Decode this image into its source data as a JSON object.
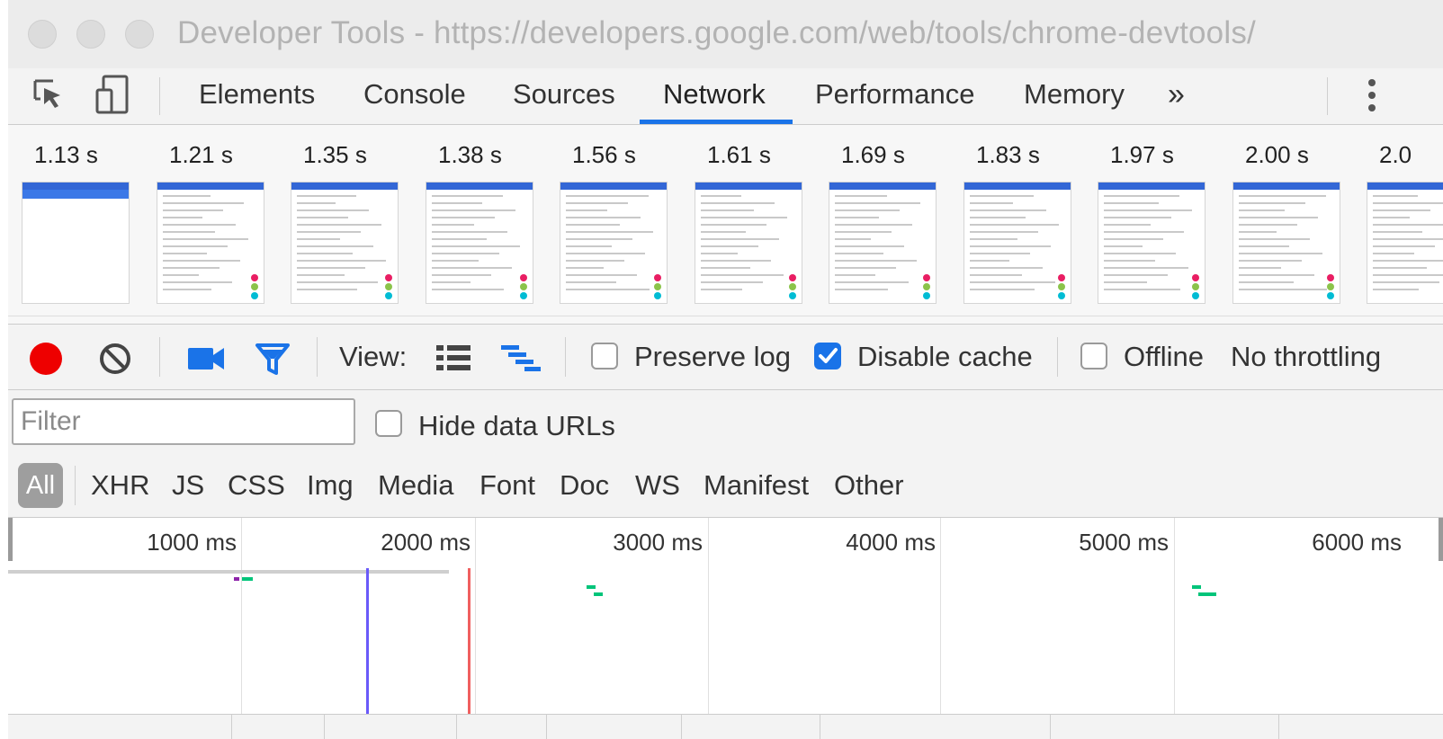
{
  "window": {
    "title": "Developer Tools - https://developers.google.com/web/tools/chrome-devtools/"
  },
  "tabs": [
    {
      "label": "Elements",
      "active": false
    },
    {
      "label": "Console",
      "active": false
    },
    {
      "label": "Sources",
      "active": false
    },
    {
      "label": "Network",
      "active": true
    },
    {
      "label": "Performance",
      "active": false
    },
    {
      "label": "Memory",
      "active": false
    }
  ],
  "more_tabs_glyph": "»",
  "icons": {
    "inspect": "inspect-element-icon",
    "device": "device-toolbar-icon",
    "more": "kebab-menu-icon",
    "record": "record-icon",
    "clear": "clear-icon",
    "screenshots": "video-camera-icon",
    "filter": "funnel-filter-icon",
    "large_rows": "list-view-icon",
    "waterfall": "waterfall-view-icon"
  },
  "filmstrip": {
    "frames": [
      "1.13 s",
      "1.21 s",
      "1.35 s",
      "1.38 s",
      "1.56 s",
      "1.61 s",
      "1.69 s",
      "1.83 s",
      "1.97 s",
      "2.00 s",
      "2.0"
    ]
  },
  "toolbar": {
    "view_label": "View:",
    "preserve_log": {
      "label": "Preserve log",
      "checked": false
    },
    "disable_cache": {
      "label": "Disable cache",
      "checked": true
    },
    "offline": {
      "label": "Offline",
      "checked": false
    },
    "throttling": "No throttling"
  },
  "filter": {
    "placeholder": "Filter",
    "hide_data_urls": {
      "label": "Hide data URLs",
      "checked": false
    }
  },
  "resource_types": [
    "All",
    "XHR",
    "JS",
    "CSS",
    "Img",
    "Media",
    "Font",
    "Doc",
    "WS",
    "Manifest",
    "Other"
  ],
  "overview": {
    "labels": [
      "1000 ms",
      "2000 ms",
      "3000 ms",
      "4000 ms",
      "5000 ms",
      "6000 ms"
    ]
  },
  "colors": {
    "accent": "#1a73e8",
    "record": "#ee0000",
    "dom_content_loaded_line": "#6a5af9",
    "load_line": "#f06060",
    "request_bar": "#00c47a"
  }
}
